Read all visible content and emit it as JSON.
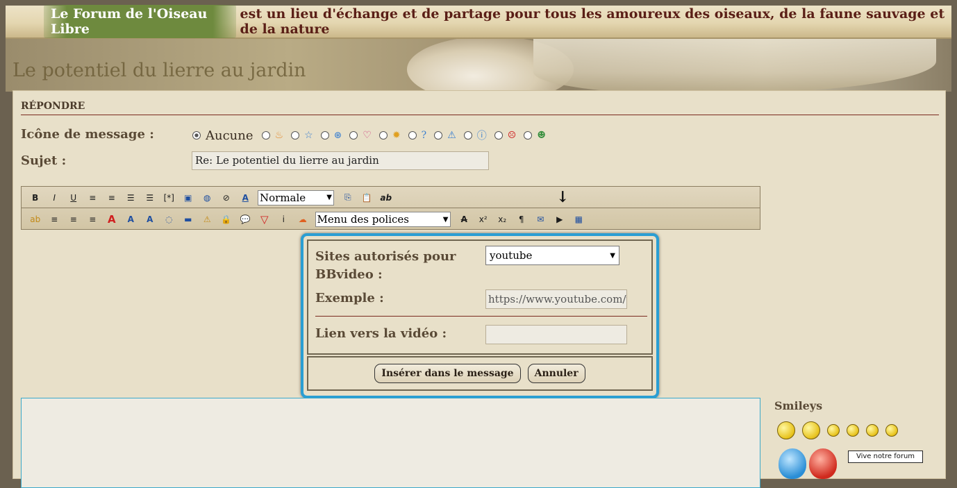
{
  "topbar": {
    "forum_name": "Le Forum de l'Oiseau Libre",
    "tagline": "est un lieu d'échange et de partage pour tous les amoureux des oiseaux, de la faune sauvage et de la nature"
  },
  "page_title": "Le potentiel du lierre au jardin",
  "reply_section": {
    "heading": "RÉPONDRE",
    "message_icon_label": "Icône de message :",
    "icon_none_label": "Aucune",
    "icons": [
      "fire-icon",
      "star-icon",
      "gear-icon",
      "heart-icon",
      "lightbulb-icon",
      "question-icon",
      "warning-icon",
      "info-icon",
      "angry-icon",
      "sick-icon"
    ],
    "subject_label": "Sujet :",
    "subject_value": "Re: Le potentiel du lierre au jardin"
  },
  "toolbar": {
    "row1": [
      "B",
      "I",
      "U",
      "≡",
      "≡",
      "☰",
      "☰",
      "[*]",
      "▣",
      "◍",
      "⊘",
      "A"
    ],
    "size_select": "Normale",
    "row1_after": [
      "⎘",
      "📋",
      "ab"
    ],
    "row2": [
      "ab",
      "≡",
      "≡",
      "≡",
      "A",
      "A",
      "A",
      "◌",
      "▬",
      "⚠",
      "🔒",
      "💬",
      "▽",
      "i",
      "☁"
    ],
    "font_select": "Menu des polices",
    "row2_after": [
      "A",
      "x²",
      "x₂",
      "¶",
      "✉",
      "▶",
      "▦"
    ]
  },
  "video_dialog": {
    "sites_label": "Sites autorisés pour BBvideo :",
    "sites_value": "youtube",
    "example_label": "Exemple :",
    "example_value": "https://www.youtube.com/watch?v=",
    "link_label": "Lien vers la vidéo :",
    "link_value": "",
    "insert_button": "Insérer dans le message",
    "cancel_button": "Annuler"
  },
  "smileys": {
    "title": "Smileys",
    "sign_text": "Vive notre forum"
  },
  "colors": {
    "accent_border": "#2a9ed3",
    "title_color": "#5a1e16",
    "forum_badge": "#6e8a3e"
  }
}
